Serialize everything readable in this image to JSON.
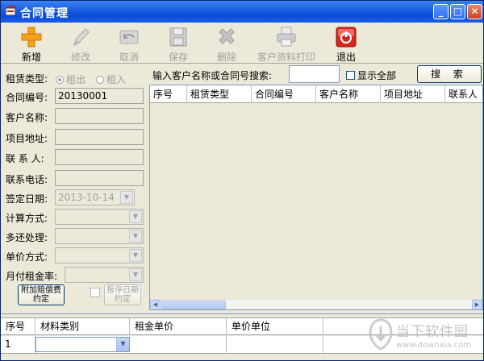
{
  "window": {
    "title": "合同管理"
  },
  "titlebar_buttons": {
    "minimize": "_",
    "maximize": "□",
    "close": "✕"
  },
  "toolbar": [
    {
      "label": "新增",
      "icon": "plus-icon",
      "enabled": true
    },
    {
      "label": "修改",
      "icon": "pencil-icon",
      "enabled": false
    },
    {
      "label": "取消",
      "icon": "undo-icon",
      "enabled": false
    },
    {
      "label": "保存",
      "icon": "floppy-disk-icon",
      "enabled": false
    },
    {
      "label": "删除",
      "icon": "delete-x-icon",
      "enabled": false
    },
    {
      "label": "客户资料打印",
      "icon": "printer-icon",
      "enabled": false
    },
    {
      "label": "退出",
      "icon": "power-icon",
      "enabled": true
    }
  ],
  "form": {
    "lease_type_label": "租赁类型:",
    "lease_out": "租出",
    "lease_in": "租入",
    "contract_no_label": "合同编号:",
    "contract_no_value": "20130001",
    "customer_name_label": "客户名称:",
    "project_addr_label": "项目地址:",
    "contact_label": "联 系 人:",
    "phone_label": "联系电话:",
    "sign_date_label": "签定日期:",
    "sign_date_value": "2013-10-14",
    "calc_method_label": "计算方式:",
    "over_return_label": "多还处理:",
    "unit_price_label": "单价方式:",
    "monthly_rate_label": "月付租金率:",
    "extra_fee_btn_line1": "附加赔偿费",
    "extra_fee_btn_line2": "约定",
    "stop_date_btn_line1": "报停日期",
    "stop_date_btn_line2": "约定"
  },
  "search": {
    "label": "输入客户名称或合同号搜索:",
    "value": "",
    "show_all": "显示全部",
    "button": "搜 索"
  },
  "results_grid": {
    "columns": [
      "序号",
      "租赁类型",
      "合同编号",
      "客户名称",
      "项目地址",
      "联系人"
    ]
  },
  "material_grid": {
    "columns": [
      "序号",
      "材料类别",
      "租金单价",
      "单价单位"
    ],
    "rows": [
      {
        "index": "1",
        "category": "",
        "price": "",
        "unit": ""
      }
    ]
  },
  "watermark": {
    "title": "当下软件园",
    "url": "www.downxia.com"
  },
  "colors": {
    "titlebar": "#0a4cd6",
    "window_bg": "#ece9d8",
    "disabled_text": "#a0a0a0",
    "accent_red": "#d8261c",
    "plus_orange": "#f5a219"
  }
}
